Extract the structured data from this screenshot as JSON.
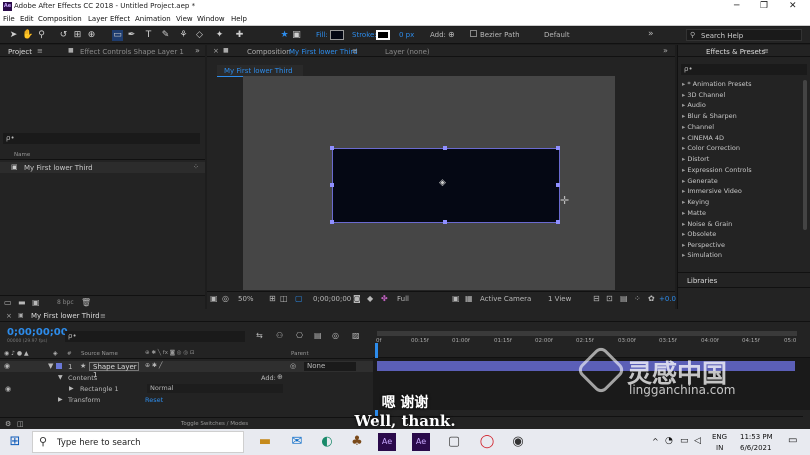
{
  "title_bar": {
    "title": "Adobe After Effects CC 2018 - Untitled Project.aep *",
    "logo": "Ae"
  },
  "menu": [
    "File",
    "Edit",
    "Composition",
    "Layer",
    "Effect",
    "Animation",
    "View",
    "Window",
    "Help"
  ],
  "toolbar": {
    "fill_label": "Fill:",
    "stroke_label": "Stroke:",
    "stroke_px": "0 px",
    "add_label": "Add:",
    "bezier_label": "Bezier Path",
    "workspace": "Default",
    "search_placeholder": "Search Help"
  },
  "project_panel": {
    "tab": "Project",
    "effect_controls_tab": "Effect Controls Shape Layer 1",
    "search_placeholder": "ρ•",
    "column_name": "Name",
    "items": [
      {
        "name": "My First lower Third"
      }
    ],
    "bpc": "8 bpc"
  },
  "composition_panel": {
    "tab_prefix": "Composition",
    "tab_name": "My First lower Third",
    "layer_tab": "Layer (none)",
    "sub_tab": "My First lower Third",
    "zoom": "50%",
    "timecode": "0;00;00;00",
    "resolution": "Full",
    "camera": "Active Camera",
    "views": "1 View",
    "exposure": "+0.0"
  },
  "effects_panel": {
    "tab": "Effects & Presets",
    "search_placeholder": "ρ•",
    "items": [
      "* Animation Presets",
      "3D Channel",
      "Audio",
      "Blur & Sharpen",
      "Channel",
      "CINEMA 4D",
      "Color Correction",
      "Distort",
      "Expression Controls",
      "Generate",
      "Immersive Video",
      "Keying",
      "Matte",
      "Noise & Grain",
      "Obsolete",
      "Perspective",
      "Simulation"
    ],
    "libraries_tab": "Libraries"
  },
  "timeline": {
    "comp_tab": "My First lower Third",
    "timecode": "0;00;00;00",
    "fps": "00000 (29.97 fps)",
    "search_placeholder": "ρ•",
    "col_source": "Source Name",
    "col_parent": "Parent",
    "layer": {
      "index": "1",
      "name": "Shape Layer 1",
      "parent": "None"
    },
    "contents_label": "Contents",
    "add_label": "Add:",
    "rectangle_label": "Rectangle 1",
    "blend_mode": "Normal",
    "transform_label": "Transform",
    "reset_label": "Reset",
    "toggle_label": "Toggle Switches / Modes",
    "ruler": [
      "0f",
      "00:15f",
      "01:00f",
      "01:15f",
      "02:00f",
      "02:15f",
      "03:00f",
      "03:15f",
      "04:00f",
      "04:15f",
      "05:0"
    ]
  },
  "subtitle": {
    "line1": "嗯 谢谢",
    "line2": "Well, thank."
  },
  "watermark": {
    "cn": "灵感中国",
    "url": "lingganchina.com"
  },
  "taskbar": {
    "search_placeholder": "Type here to search",
    "lang": "ENG",
    "region": "IN",
    "time": "11:53 PM",
    "date": "6/6/2021"
  },
  "colors": {
    "accent": "#2d8ceb",
    "layer_bar": "#5b5fb7",
    "shape_fill": "#050814",
    "handle": "#8f8fff"
  }
}
